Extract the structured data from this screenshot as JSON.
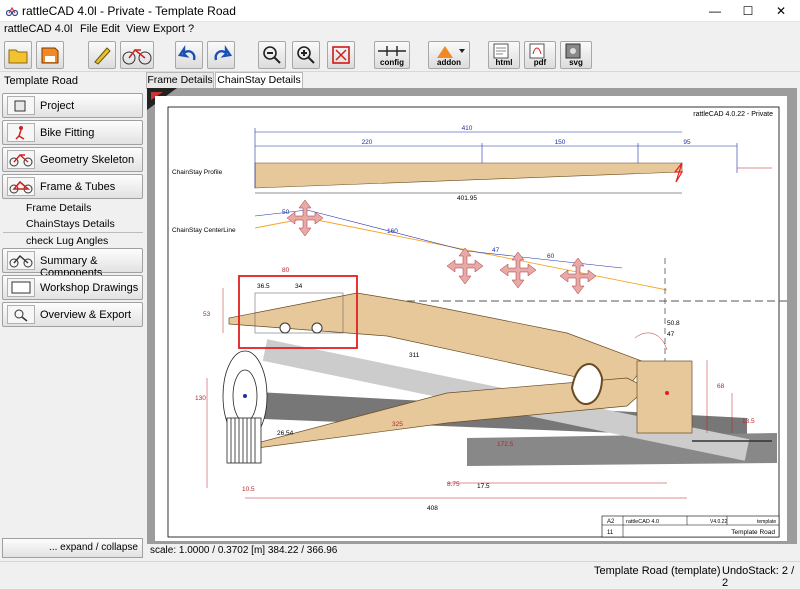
{
  "window": {
    "title": "rattleCAD 4.0l - Private - Template Road",
    "minimize": "—",
    "maximize": "☐",
    "close": "✕"
  },
  "menu": {
    "app": "rattleCAD 4.0l",
    "file": "File",
    "edit": "Edit",
    "view": "View",
    "export": "Export",
    "help": "?"
  },
  "toolbar": {
    "config": "config",
    "addon": "addon",
    "html": "html",
    "pdf": "pdf",
    "svg": "svg"
  },
  "sidebar": {
    "header": "Template Road",
    "project": "Project",
    "bike_fitting": "Bike Fitting",
    "geometry_skeleton": "Geometry Skeleton",
    "frame_tubes": "Frame & Tubes",
    "frame_details": "Frame Details",
    "chainstays_details": "ChainStays Details",
    "check_lug_angles": "check Lug Angles",
    "summary_components": "Summary & Components",
    "workshop_drawings": "Workshop Drawings",
    "overview_export": "Overview & Export",
    "expand_collapse": "... expand / collapse"
  },
  "tabs": {
    "frame_details": "Frame Details",
    "chainstay_details": "ChainStay Details"
  },
  "drawing": {
    "header_text": "rattleCAD 4.0.22 - Private",
    "profile_label": "ChainStay Profile",
    "centerline_label": "ChainStay CenterLine",
    "dims": {
      "d410": "410",
      "d220": "220",
      "d150": "150",
      "d95": "95",
      "d40195": "401.95",
      "d50": "50",
      "d160": "160",
      "d47": "47",
      "d60": "60",
      "d80": "80",
      "d365": "36.5",
      "d34": "34",
      "d311": "311",
      "d325": "325",
      "d508": "50.8",
      "d47b": "47",
      "d68": "68",
      "d135": "13.5",
      "d2654": "26.54",
      "d1725": "172.5",
      "d175": "17.5",
      "d408": "408",
      "d130": "130",
      "d53": "53",
      "d875": "8.75",
      "d105": "10.5"
    },
    "title_block": {
      "size": "A2",
      "author": "rattleCAD 4.0",
      "version": "V4.0.22",
      "template": "template",
      "sheet": "11",
      "name": "Template Road"
    }
  },
  "status_line": "scale: 1.0000 / 0.3702  [m]  384.22 / 366.96",
  "statusbar": {
    "project": "Template Road (template)",
    "undo": "UndoStack:  2 / 2"
  },
  "colors": {
    "tube": "#e6c89a",
    "accent_red": "#e0201f",
    "centerline": "#f5a623",
    "dim_blue": "#1f2fa8",
    "dim_red": "#b8242a"
  }
}
